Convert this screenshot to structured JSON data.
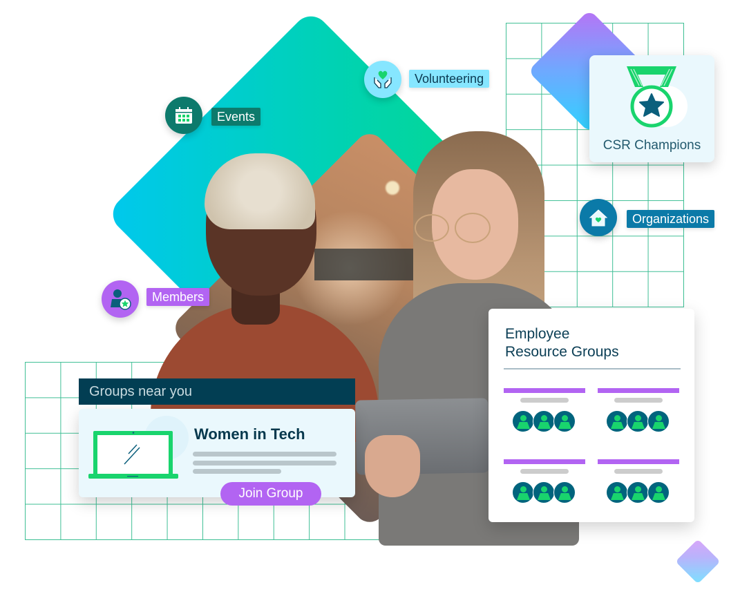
{
  "badges": {
    "events": {
      "label": "Events",
      "icon": "calendar-icon",
      "color": "#0d7a6c"
    },
    "volunteering": {
      "label": "Volunteering",
      "icon": "hands-heart-icon",
      "color": "#86e6ff"
    },
    "organizations": {
      "label": "Organizations",
      "icon": "house-heart-icon",
      "color": "#0b7aa8"
    },
    "members": {
      "label": "Members",
      "icon": "member-star-icon",
      "color": "#b264f2"
    }
  },
  "csr_card": {
    "label": "CSR Champions",
    "icon": "medal-star-icon"
  },
  "groups_near_you": {
    "header": "Groups near you",
    "group": {
      "title": "Women in Tech",
      "icon": "laptop-icon",
      "button_label": "Join Group"
    }
  },
  "erg_card": {
    "title_line1": "Employee",
    "title_line2": "Resource Groups",
    "groups": [
      {
        "members": 3
      },
      {
        "members": 3
      },
      {
        "members": 3
      },
      {
        "members": 3
      }
    ]
  },
  "colors": {
    "accent_purple": "#b264f2",
    "accent_green": "#19d46d",
    "navy": "#023e53",
    "teal": "#01647d"
  }
}
